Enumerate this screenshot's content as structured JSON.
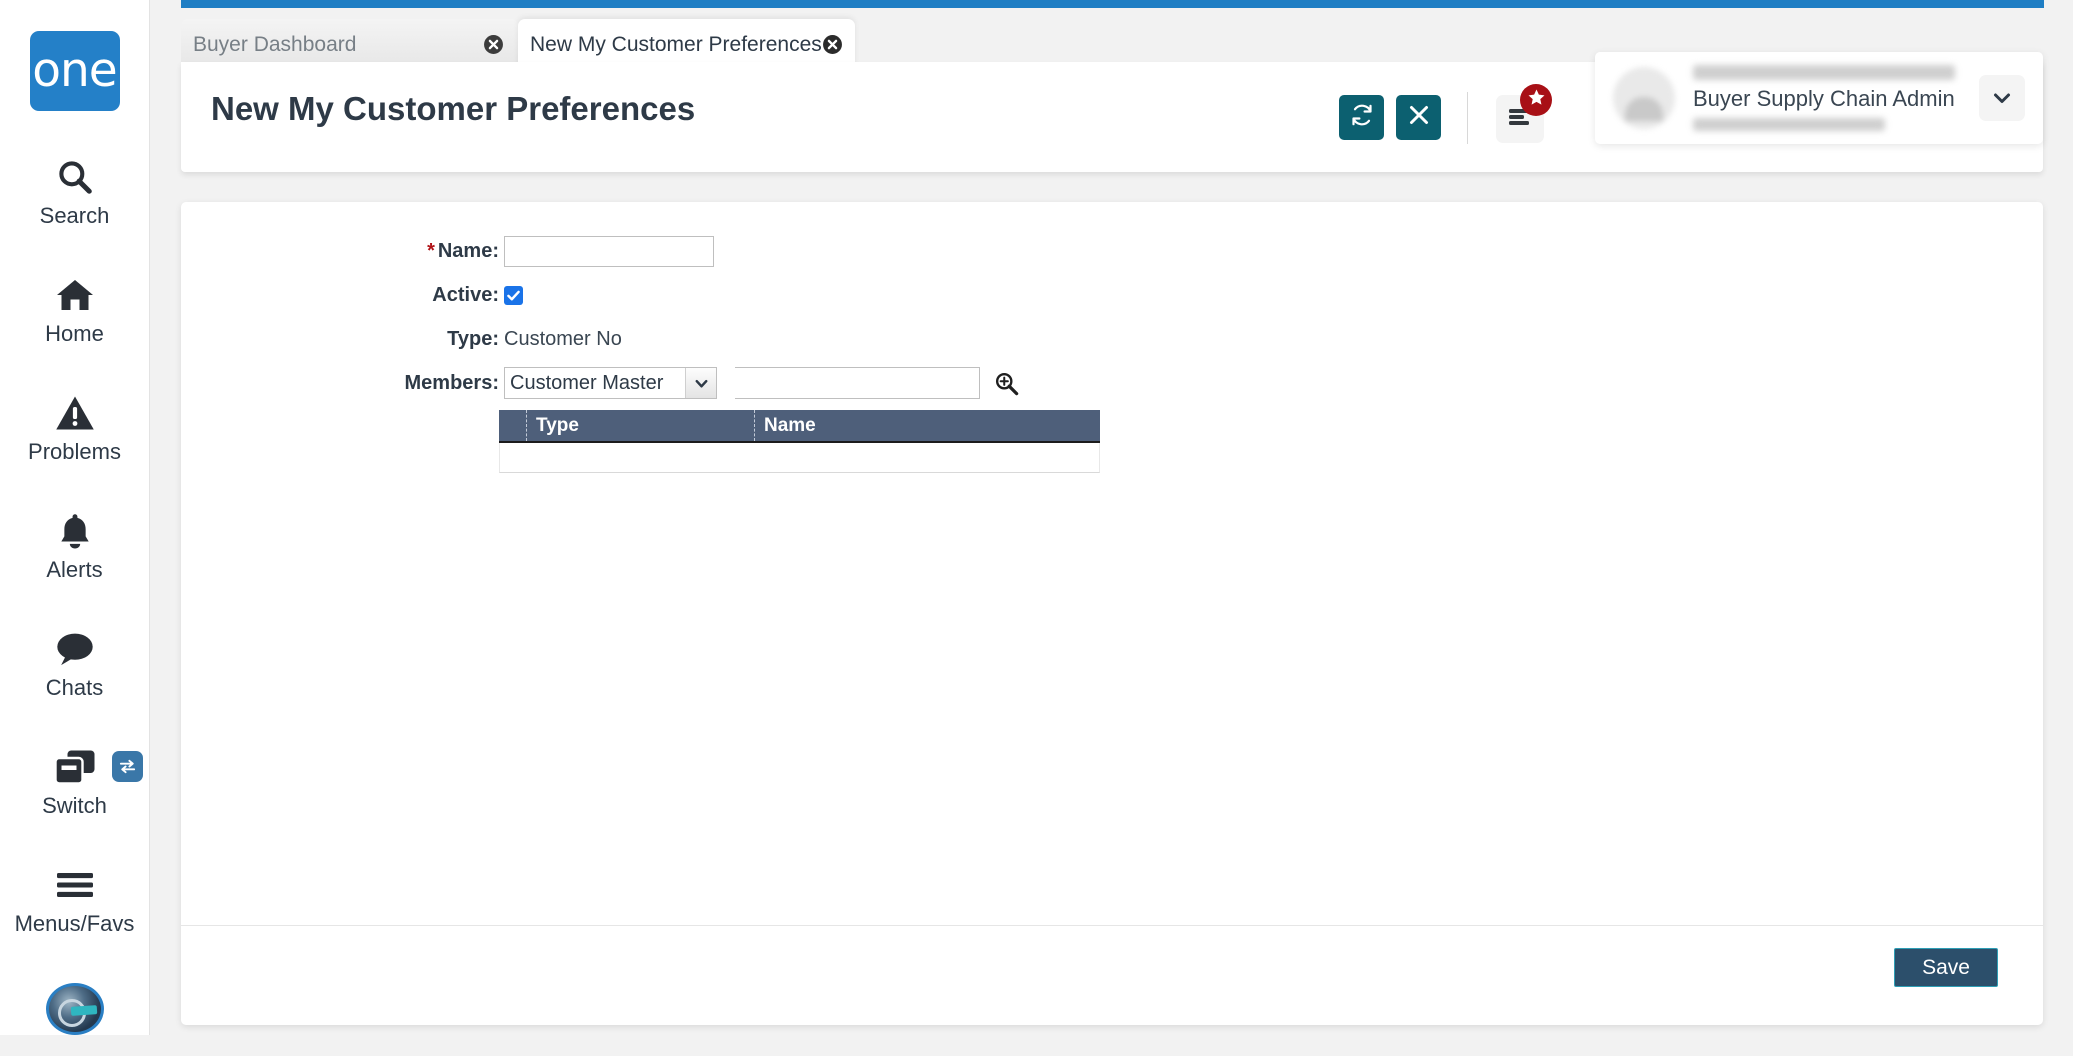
{
  "app": {
    "brand_label": "one",
    "accent_blue": "#1f7ec4",
    "accent_teal": "#0c6070",
    "grid_header_color": "#4e5f7a",
    "save_button_color": "#2c4f6b"
  },
  "sidebar": {
    "items": [
      {
        "label": "Search",
        "icon": "search-icon"
      },
      {
        "label": "Home",
        "icon": "home-icon"
      },
      {
        "label": "Problems",
        "icon": "warning-triangle-icon"
      },
      {
        "label": "Alerts",
        "icon": "bell-icon"
      },
      {
        "label": "Chats",
        "icon": "chat-bubble-icon"
      },
      {
        "label": "Switch",
        "icon": "windows-stack-icon",
        "badge_icon": "swap-arrows-icon"
      },
      {
        "label": "Menus/Favs",
        "icon": "hamburger-icon"
      }
    ],
    "assistant_icon": "ai-assistant-avatar-icon"
  },
  "tabs": [
    {
      "label": "Buyer Dashboard",
      "active": false,
      "close_icon": "close-circle-icon"
    },
    {
      "label": "New My Customer Preferences",
      "active": true,
      "close_icon": "close-circle-icon"
    }
  ],
  "header": {
    "title": "New My Customer Preferences",
    "refresh_icon": "refresh-icon",
    "close_icon": "x-icon",
    "menu_favs_icon": "menu-lines-icon",
    "favorite_badge_icon": "star-icon"
  },
  "user": {
    "name_masked": "",
    "role": "Buyer Supply Chain Admin",
    "subtitle_masked": "",
    "avatar_icon": "user-avatar",
    "caret_icon": "chevron-down-icon"
  },
  "form": {
    "fields": [
      {
        "label": "Name:",
        "required": true,
        "type": "text",
        "value": "",
        "placeholder": ""
      },
      {
        "label": "Active:",
        "required": false,
        "type": "checkbox",
        "checked": true
      },
      {
        "label": "Type:",
        "required": false,
        "type": "static",
        "value": "Customer No"
      },
      {
        "label": "Members:",
        "required": false,
        "type": "lookup",
        "select_value": "Customer Master",
        "text_value": "",
        "lookup_icon": "search-plus-icon"
      }
    ]
  },
  "members_grid": {
    "columns": [
      "Type",
      "Name"
    ],
    "rows": []
  },
  "footer": {
    "save_label": "Save"
  }
}
